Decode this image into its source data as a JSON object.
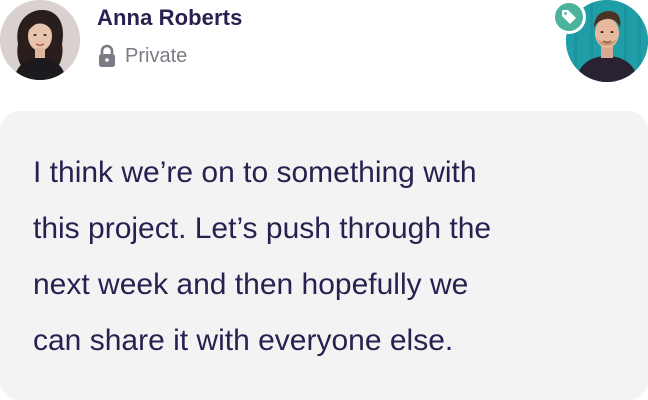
{
  "author": {
    "name": "Anna Roberts",
    "visibility": "Private",
    "avatar_icon": "person-avatar"
  },
  "recipient": {
    "avatar_icon": "person-avatar",
    "badge_icon": "tag-icon",
    "badge_color": "#4bb39b"
  },
  "message": {
    "text": "I think we’re on to something with\nthis project. Let’s push through the\nnext week and then hopefully we\ncan share it with everyone else."
  },
  "colors": {
    "text_primary": "#2b1f4f",
    "text_muted": "#7b7b86",
    "bubble_bg": "#f3f3f4",
    "accent_teal": "#1f9ea8"
  }
}
